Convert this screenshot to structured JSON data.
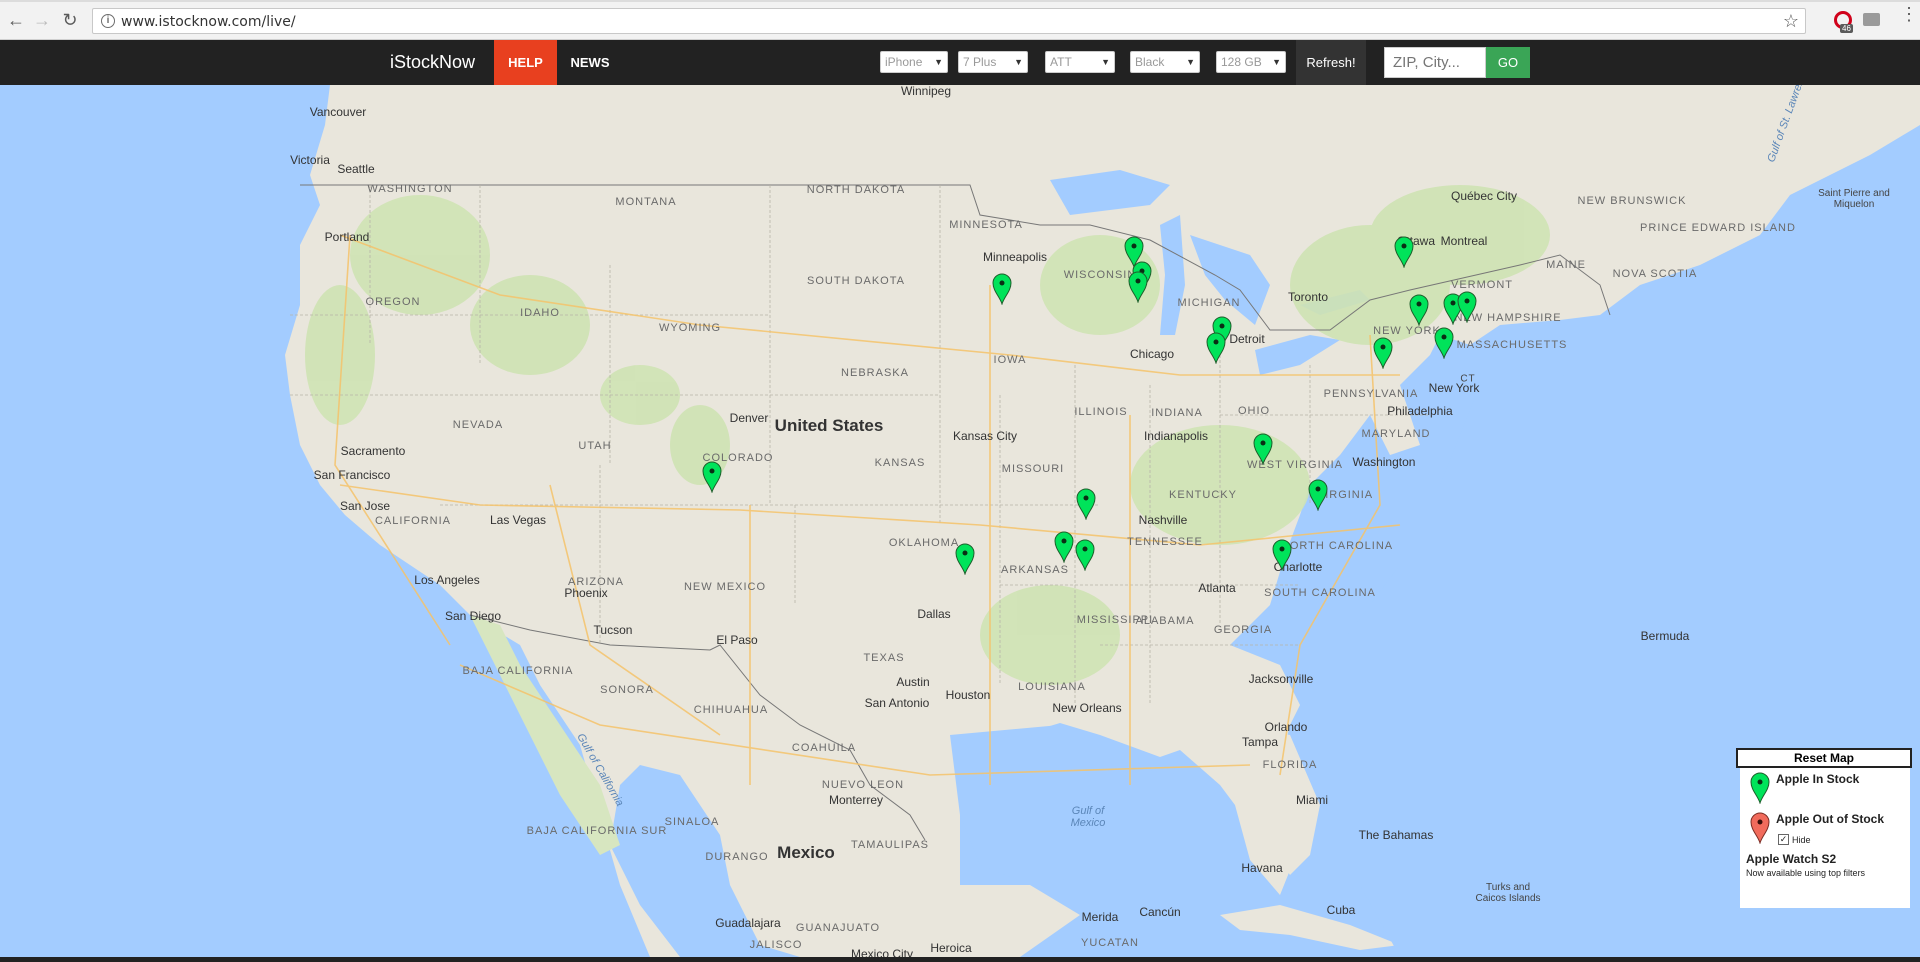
{
  "browser": {
    "url": "www.istocknow.com/live/",
    "extension_badge_count": "46"
  },
  "header": {
    "brand": "iStockNow",
    "help_label": "HELP",
    "news_label": "NEWS",
    "filters": {
      "device": "iPhone",
      "model": "7 Plus",
      "carrier": "ATT",
      "color": "Black",
      "storage": "128 GB"
    },
    "refresh_label": "Refresh!",
    "zip_placeholder": "ZIP, City...",
    "go_label": "GO"
  },
  "map": {
    "labels": {
      "countries": [
        "United States",
        "Mexico"
      ],
      "states": [
        "WASHINGTON",
        "OREGON",
        "IDAHO",
        "MONTANA",
        "WYOMING",
        "NEVADA",
        "UTAH",
        "COLORADO",
        "CALIFORNIA",
        "ARIZONA",
        "NEW MEXICO",
        "NORTH DAKOTA",
        "SOUTH DAKOTA",
        "NEBRASKA",
        "KANSAS",
        "OKLAHOMA",
        "TEXAS",
        "MINNESOTA",
        "IOWA",
        "MISSOURI",
        "ARKANSAS",
        "LOUISIANA",
        "WISCONSIN",
        "ILLINOIS",
        "MICHIGAN",
        "INDIANA",
        "OHIO",
        "KENTUCKY",
        "TENNESSEE",
        "MISSISSIPPI",
        "ALABAMA",
        "GEORGIA",
        "FLORIDA",
        "SOUTH CAROLINA",
        "NORTH CAROLINA",
        "VIRGINIA",
        "WEST VIRGINIA",
        "PENNSYLVANIA",
        "NEW YORK",
        "MARYLAND",
        "VERMONT",
        "NEW HAMPSHIRE",
        "MASSACHUSETTS",
        "MAINE",
        "CT",
        "NEW BRUNSWICK",
        "NOVA SCOTIA",
        "PRINCE EDWARD ISLAND",
        "BAJA CALIFORNIA",
        "BAJA CALIFORNIA SUR",
        "SONORA",
        "CHIHUAHUA",
        "COAHUILA",
        "NUEVO LEON",
        "TAMAULIPAS",
        "SINALOA",
        "DURANGO",
        "JALISCO",
        "GUANAJUATO",
        "YUCATAN"
      ],
      "cities": [
        "Vancouver",
        "Victoria",
        "Seattle",
        "Portland",
        "Sacramento",
        "San Francisco",
        "San Jose",
        "Las Vegas",
        "Los Angeles",
        "San Diego",
        "Phoenix",
        "Tucson",
        "Denver",
        "El Paso",
        "Winnipeg",
        "Minneapolis",
        "Kansas City",
        "Dallas",
        "Austin",
        "San Antonio",
        "Houston",
        "New Orleans",
        "Chicago",
        "Detroit",
        "Indianapolis",
        "Nashville",
        "Atlanta",
        "Charlotte",
        "Jacksonville",
        "Orlando",
        "Tampa",
        "Miami",
        "Toronto",
        "Ottawa",
        "Montreal",
        "Québec City",
        "New York",
        "Philadelphia",
        "Washington",
        "Monterrey",
        "Guadalajara",
        "Mexico City",
        "Heroica",
        "Merida",
        "Cancún",
        "Havana",
        "Cuba",
        "The Bahamas",
        "Turks and Caicos Islands",
        "Bermuda",
        "Saint Pierre and Miquelon"
      ],
      "water": [
        "Gulf of Mexico",
        "Gulf of California",
        "Gulf of St. Lawrence"
      ]
    },
    "pins": [
      {
        "status": "in-stock",
        "city": "Colorado Springs"
      },
      {
        "status": "in-stock",
        "city": "Des Moines"
      },
      {
        "status": "in-stock",
        "city": "Milwaukee"
      },
      {
        "status": "in-stock",
        "city": "Chicago North"
      },
      {
        "status": "in-stock",
        "city": "Chicago"
      },
      {
        "status": "in-stock",
        "city": "Dayton"
      },
      {
        "status": "in-stock",
        "city": "Cincinnati"
      },
      {
        "status": "in-stock",
        "city": "Syracuse"
      },
      {
        "status": "in-stock",
        "city": "Harrisburg"
      },
      {
        "status": "in-stock",
        "city": "New York West"
      },
      {
        "status": "in-stock",
        "city": "New York East"
      },
      {
        "status": "in-stock",
        "city": "New Jersey Coast"
      },
      {
        "status": "in-stock",
        "city": "Washington"
      },
      {
        "status": "in-stock",
        "city": "Greenville"
      },
      {
        "status": "in-stock",
        "city": "Charleston"
      },
      {
        "status": "in-stock",
        "city": "Jacksonville"
      },
      {
        "status": "in-stock",
        "city": "Jackson"
      },
      {
        "status": "in-stock",
        "city": "Baton Rouge"
      },
      {
        "status": "in-stock",
        "city": "New Orleans"
      },
      {
        "status": "in-stock",
        "city": "Houston"
      }
    ]
  },
  "legend": {
    "reset_label": "Reset Map",
    "in_stock_label": "Apple In Stock",
    "out_of_stock_label": "Apple Out of Stock",
    "hide_label": "Hide",
    "hide_checked": true,
    "watch_title": "Apple Watch S2",
    "watch_subtitle": "Now available using top filters",
    "colors": {
      "in_stock": "#00e35a",
      "out_of_stock": "#f16b5c"
    }
  }
}
